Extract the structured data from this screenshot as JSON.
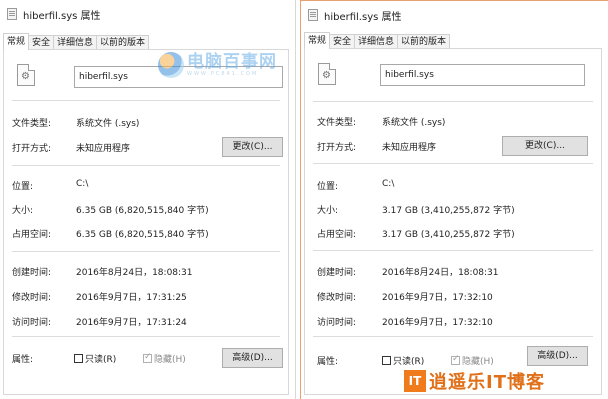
{
  "left_dialog": {
    "title": "hiberfil.sys 属性",
    "tabs": [
      "常规",
      "安全",
      "详细信息",
      "以前的版本"
    ],
    "filename": "hiberfil.sys",
    "file_type_label": "文件类型:",
    "file_type_value": "系统文件 (.sys)",
    "open_with_label": "打开方式:",
    "open_with_value": "未知应用程序",
    "change_button": "更改(C)...",
    "location_label": "位置:",
    "location_value": "C:\\",
    "size_label": "大小:",
    "size_value": "6.35 GB (6,820,515,840 字节)",
    "size_on_disk_label": "占用空间:",
    "size_on_disk_value": "6.35 GB (6,820,515,840 字节)",
    "created_label": "创建时间:",
    "created_value": "2016年8月24日，18:08:31",
    "modified_label": "修改时间:",
    "modified_value": "2016年9月7日，17:31:25",
    "accessed_label": "访问时间:",
    "accessed_value": "2016年9月7日，17:31:24",
    "attributes_label": "属性:",
    "readonly_label": "只读(R)",
    "hidden_label": "隐藏(H)",
    "advanced_button": "高级(D)..."
  },
  "right_dialog": {
    "title": "hiberfil.sys 属性",
    "tabs": [
      "常规",
      "安全",
      "详细信息",
      "以前的版本"
    ],
    "filename": "hiberfil.sys",
    "file_type_label": "文件类型:",
    "file_type_value": "系统文件 (.sys)",
    "open_with_label": "打开方式:",
    "open_with_value": "未知应用程序",
    "change_button": "更改(C)...",
    "location_label": "位置:",
    "location_value": "C:\\",
    "size_label": "大小:",
    "size_value": "3.17 GB (3,410,255,872 字节)",
    "size_on_disk_label": "占用空间:",
    "size_on_disk_value": "3.17 GB (3,410,255,872 字节)",
    "created_label": "创建时间:",
    "created_value": "2016年8月24日，18:08:31",
    "modified_label": "修改时间:",
    "modified_value": "2016年9月7日，17:32:10",
    "accessed_label": "访问时间:",
    "accessed_value": "2016年9月7日，17:32:10",
    "attributes_label": "属性:",
    "readonly_label": "只读(R)",
    "hidden_label": "隐藏(H)",
    "advanced_button": "高级(D)..."
  },
  "watermark": {
    "main": "电脑百事网",
    "sub": "WWW.PC841.COM"
  },
  "brand": {
    "box": "IT",
    "text": "逍遥乐IT博客"
  },
  "icons": {
    "file": "system-file-icon",
    "gear": "gear-icon",
    "title": "file-properties-icon"
  },
  "colors": {
    "accent_border": "#e8a070",
    "button_bg": "#e1e1e1",
    "brand_orange": "#f07b1a"
  }
}
